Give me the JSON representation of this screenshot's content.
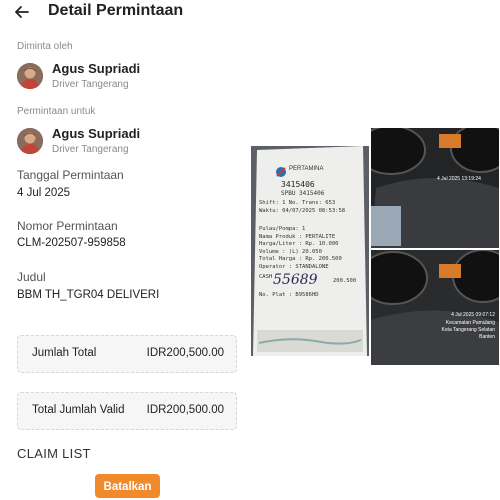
{
  "header": {
    "title": "Detail Permintaan"
  },
  "requested_by": {
    "label": "Diminta oleh",
    "name": "Agus Supriadi",
    "role": "Driver Tangerang"
  },
  "requested_for": {
    "label": "Permintaan untuk",
    "name": "Agus Supriadi",
    "role": "Driver Tangerang"
  },
  "fields": {
    "date_label": "Tanggal Permintaan",
    "date_value": "4 Jul 2025",
    "number_label": "Nomor Permintaan",
    "number_value": "CLM-202507-959858",
    "title_label": "Judul",
    "title_value": "BBM TH_TGR04 DELIVERI"
  },
  "amounts": {
    "total_label": "Jumlah Total",
    "total_value": "IDR200,500.00",
    "valid_label": "Total Jumlah Valid",
    "valid_value": "IDR200,500.00"
  },
  "claim_list_label": "CLAIM LIST",
  "cancel_button": "Batalkan",
  "receipt": {
    "brand": "PERTAMINA",
    "station": "3415406",
    "spbu": "SPBU 3415406",
    "shift_line": "Shift: 1    No. Trans: 653",
    "time_line": "Waktu: 04/07/2025 08:53:58",
    "lines": [
      "Pulau/Pompa: 1",
      "Nama Produk : PERTALITE",
      "Harga/Liter : Rp. 10.000",
      "Volume      : (L) 20.050",
      "Total Harga : Rp. 200.500",
      "Operator    : STANDALONE"
    ],
    "cash_label": "CASH",
    "cash_value": "200.500",
    "handwritten": "55689",
    "plate_line": "No. Plat : B9586HD"
  },
  "photo_stamps": [
    "4 Jul 2025 13:19:24",
    "4 Jul 2025 09:07:12",
    "Kecamatan Pamulang",
    "Kota Tangerang Selatan",
    "Banten"
  ]
}
